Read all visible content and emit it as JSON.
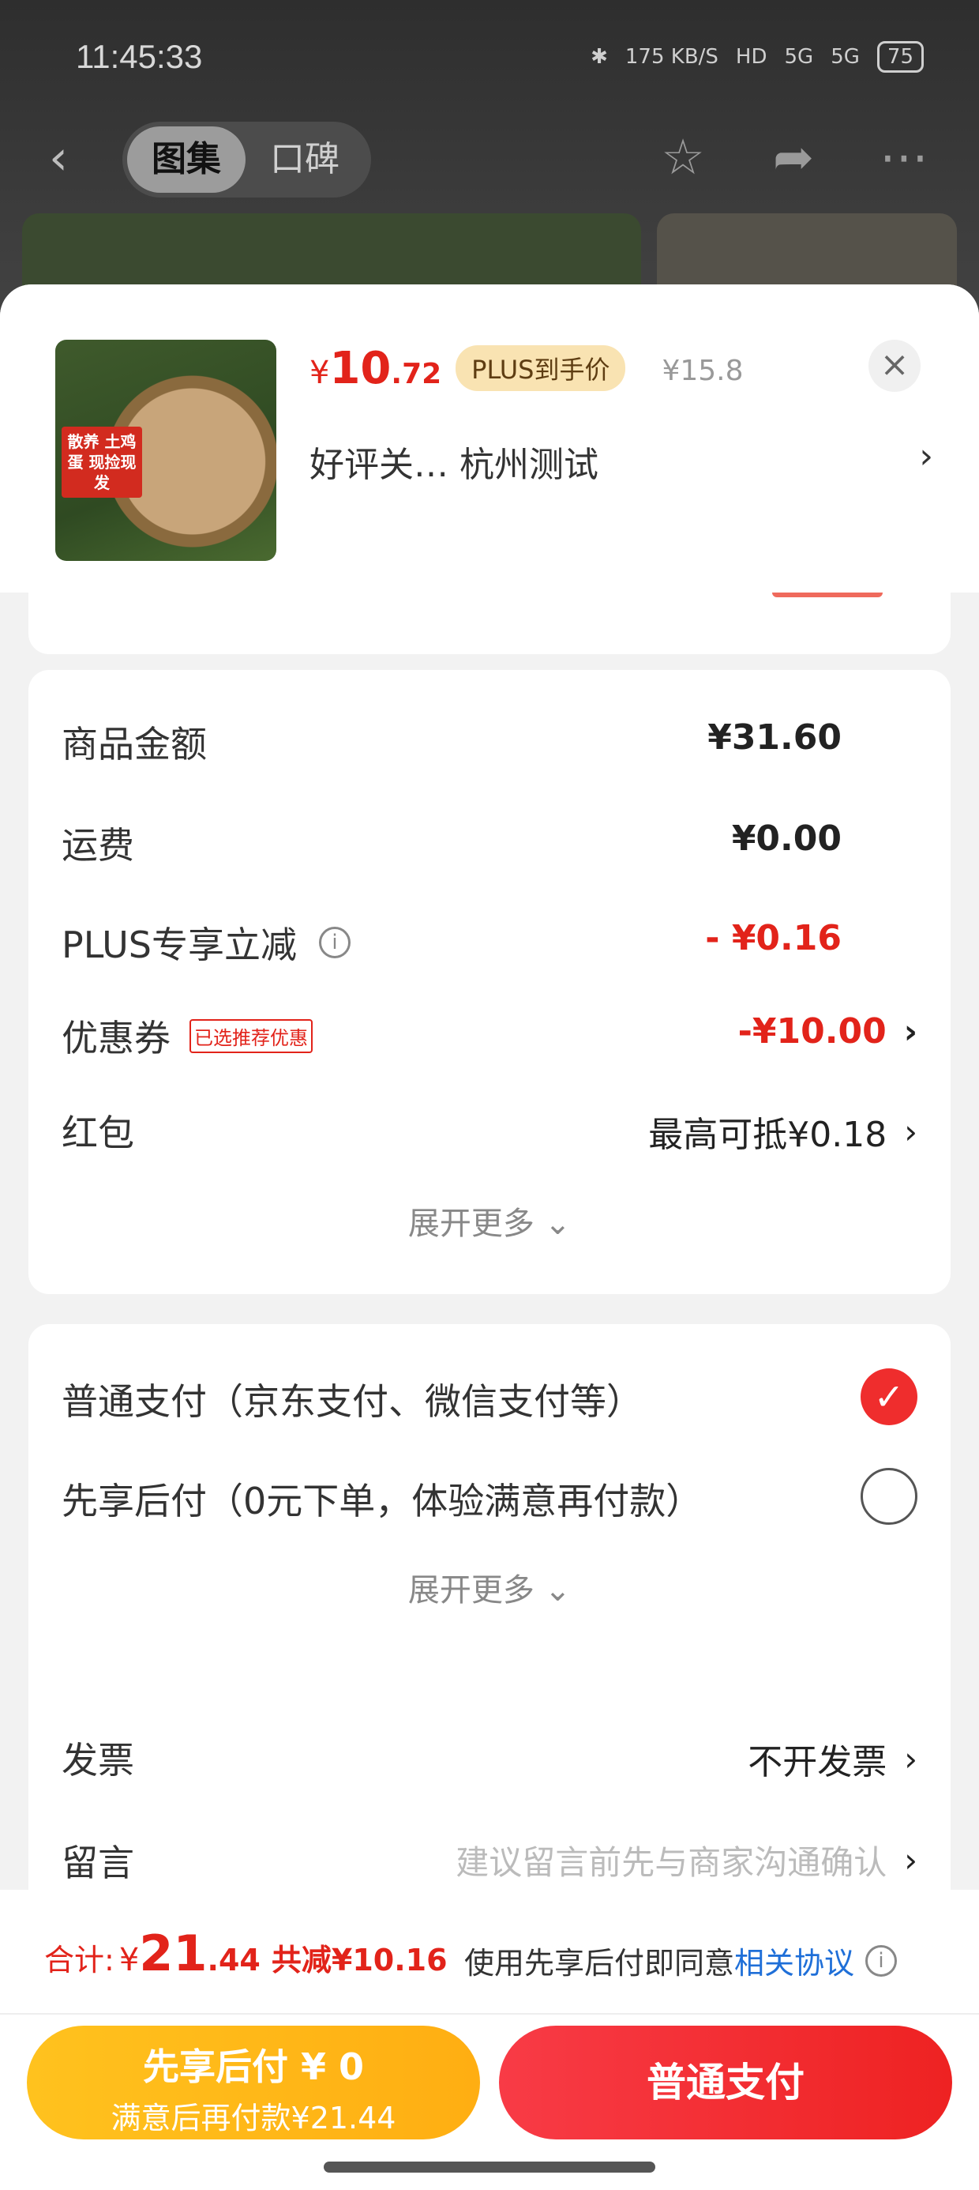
{
  "status_bar": {
    "time": "11:45:33",
    "speed": "175 KB/S",
    "network1": "HD",
    "network2": "5G",
    "network3": "5G",
    "battery": "75"
  },
  "nav": {
    "tabs": [
      {
        "label": "图集",
        "active": true
      },
      {
        "label": "口碑",
        "active": false
      }
    ],
    "icons": [
      "back-icon",
      "star-icon",
      "share-icon",
      "more-icon"
    ]
  },
  "product": {
    "price_symbol": "¥",
    "price_integer": "10",
    "price_decimal": ".72",
    "plus_label": "PLUS到手价",
    "original_price": "¥15.8",
    "spec": "好评关…  杭州测试",
    "image_tag": "散养 土鸡蛋 现捡现发"
  },
  "summary": {
    "rows": [
      {
        "label": "商品金额",
        "value": "¥31.60"
      },
      {
        "label": "运费",
        "value": "¥0.00"
      },
      {
        "label": "PLUS专享立减",
        "value": "- ¥0.16"
      },
      {
        "label": "优惠券",
        "tag": "已选推荐优惠",
        "value": "-¥10.00"
      },
      {
        "label": "红包",
        "value": "最高可抵¥0.18"
      }
    ],
    "expand_label": "展开更多"
  },
  "payment": {
    "options": [
      {
        "label": "普通支付（京东支付、微信支付等）",
        "selected": true
      },
      {
        "label": "先享后付（0元下单，体验满意再付款）",
        "selected": false
      }
    ],
    "expand_label": "展开更多"
  },
  "extras": {
    "invoice_label": "发票",
    "invoice_value": "不开发票",
    "note_label": "留言",
    "note_placeholder": "建议留言前先与商家沟通确认"
  },
  "footer": {
    "total_label": "合计:",
    "total_symbol": "¥",
    "total_integer": "21",
    "total_decimal": ".44",
    "total_save": "共减¥10.16",
    "agree_text": "使用先享后付即同意",
    "agree_link": "相关协议",
    "btn_later_main": "先享后付 ¥ 0",
    "btn_later_sub": "满意后再付款¥21.44",
    "btn_pay": "普通支付"
  }
}
